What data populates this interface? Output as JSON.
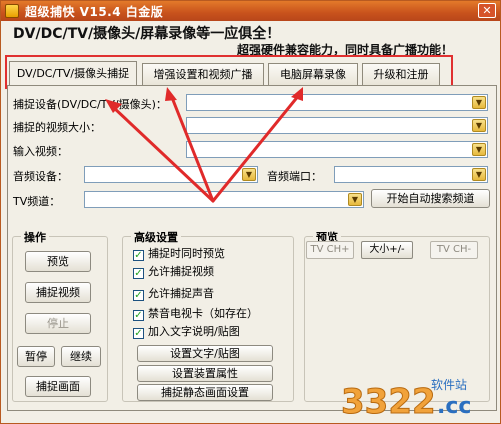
{
  "window": {
    "title": "超级捕快 V15.4 白金版",
    "close_label": "✕"
  },
  "banner": {
    "headline": "DV/DC/TV/摄像头/屏幕录像等一应俱全！",
    "subline": "超强硬件兼容能力，同时具备广播功能！"
  },
  "tabs": [
    {
      "label": "DV/DC/TV/摄像头捕捉",
      "active": true
    },
    {
      "label": "增强设置和视频广播"
    },
    {
      "label": "电脑屏幕录像"
    },
    {
      "label": "升级和注册"
    }
  ],
  "fields": {
    "capture_device_label": "捕捉设备(DV/DC/TV/摄像头)：",
    "capture_size_label": "捕捉的视频大小：",
    "input_video_label": "输入视频：",
    "audio_device_label": "音频设备：",
    "audio_port_label": "音频端口：",
    "tv_channel_label": "TV频道：",
    "auto_search_label": "开始自动搜索频道"
  },
  "ops": {
    "title": "操作",
    "preview": "预览",
    "capture_video": "捕捉视频",
    "stop": "停止",
    "pause": "暂停",
    "resume": "继续",
    "capture_image": "捕捉画面"
  },
  "advanced": {
    "title": "高级设置",
    "options": [
      {
        "label": "捕捉时同时预览",
        "checked": true
      },
      {
        "label": "允许捕捉视频",
        "checked": true
      },
      {
        "label": "允许捕捉声音",
        "checked": true
      },
      {
        "label": "禁音电视卡（如存在）",
        "checked": true
      },
      {
        "label": "加入文字说明/贴图",
        "checked": true
      }
    ],
    "set_text": "设置文字/贴图",
    "device_props": "设置装置属性",
    "capture_still": "捕捉静态画面设置"
  },
  "preview_group": {
    "title": "预览",
    "tv_ch_plus": "TV CH+",
    "size": "大小+/-",
    "tv_ch_minus": "TV CH-"
  },
  "watermark": {
    "number": "3322",
    "site": "软件站",
    "domain": ".cc"
  }
}
